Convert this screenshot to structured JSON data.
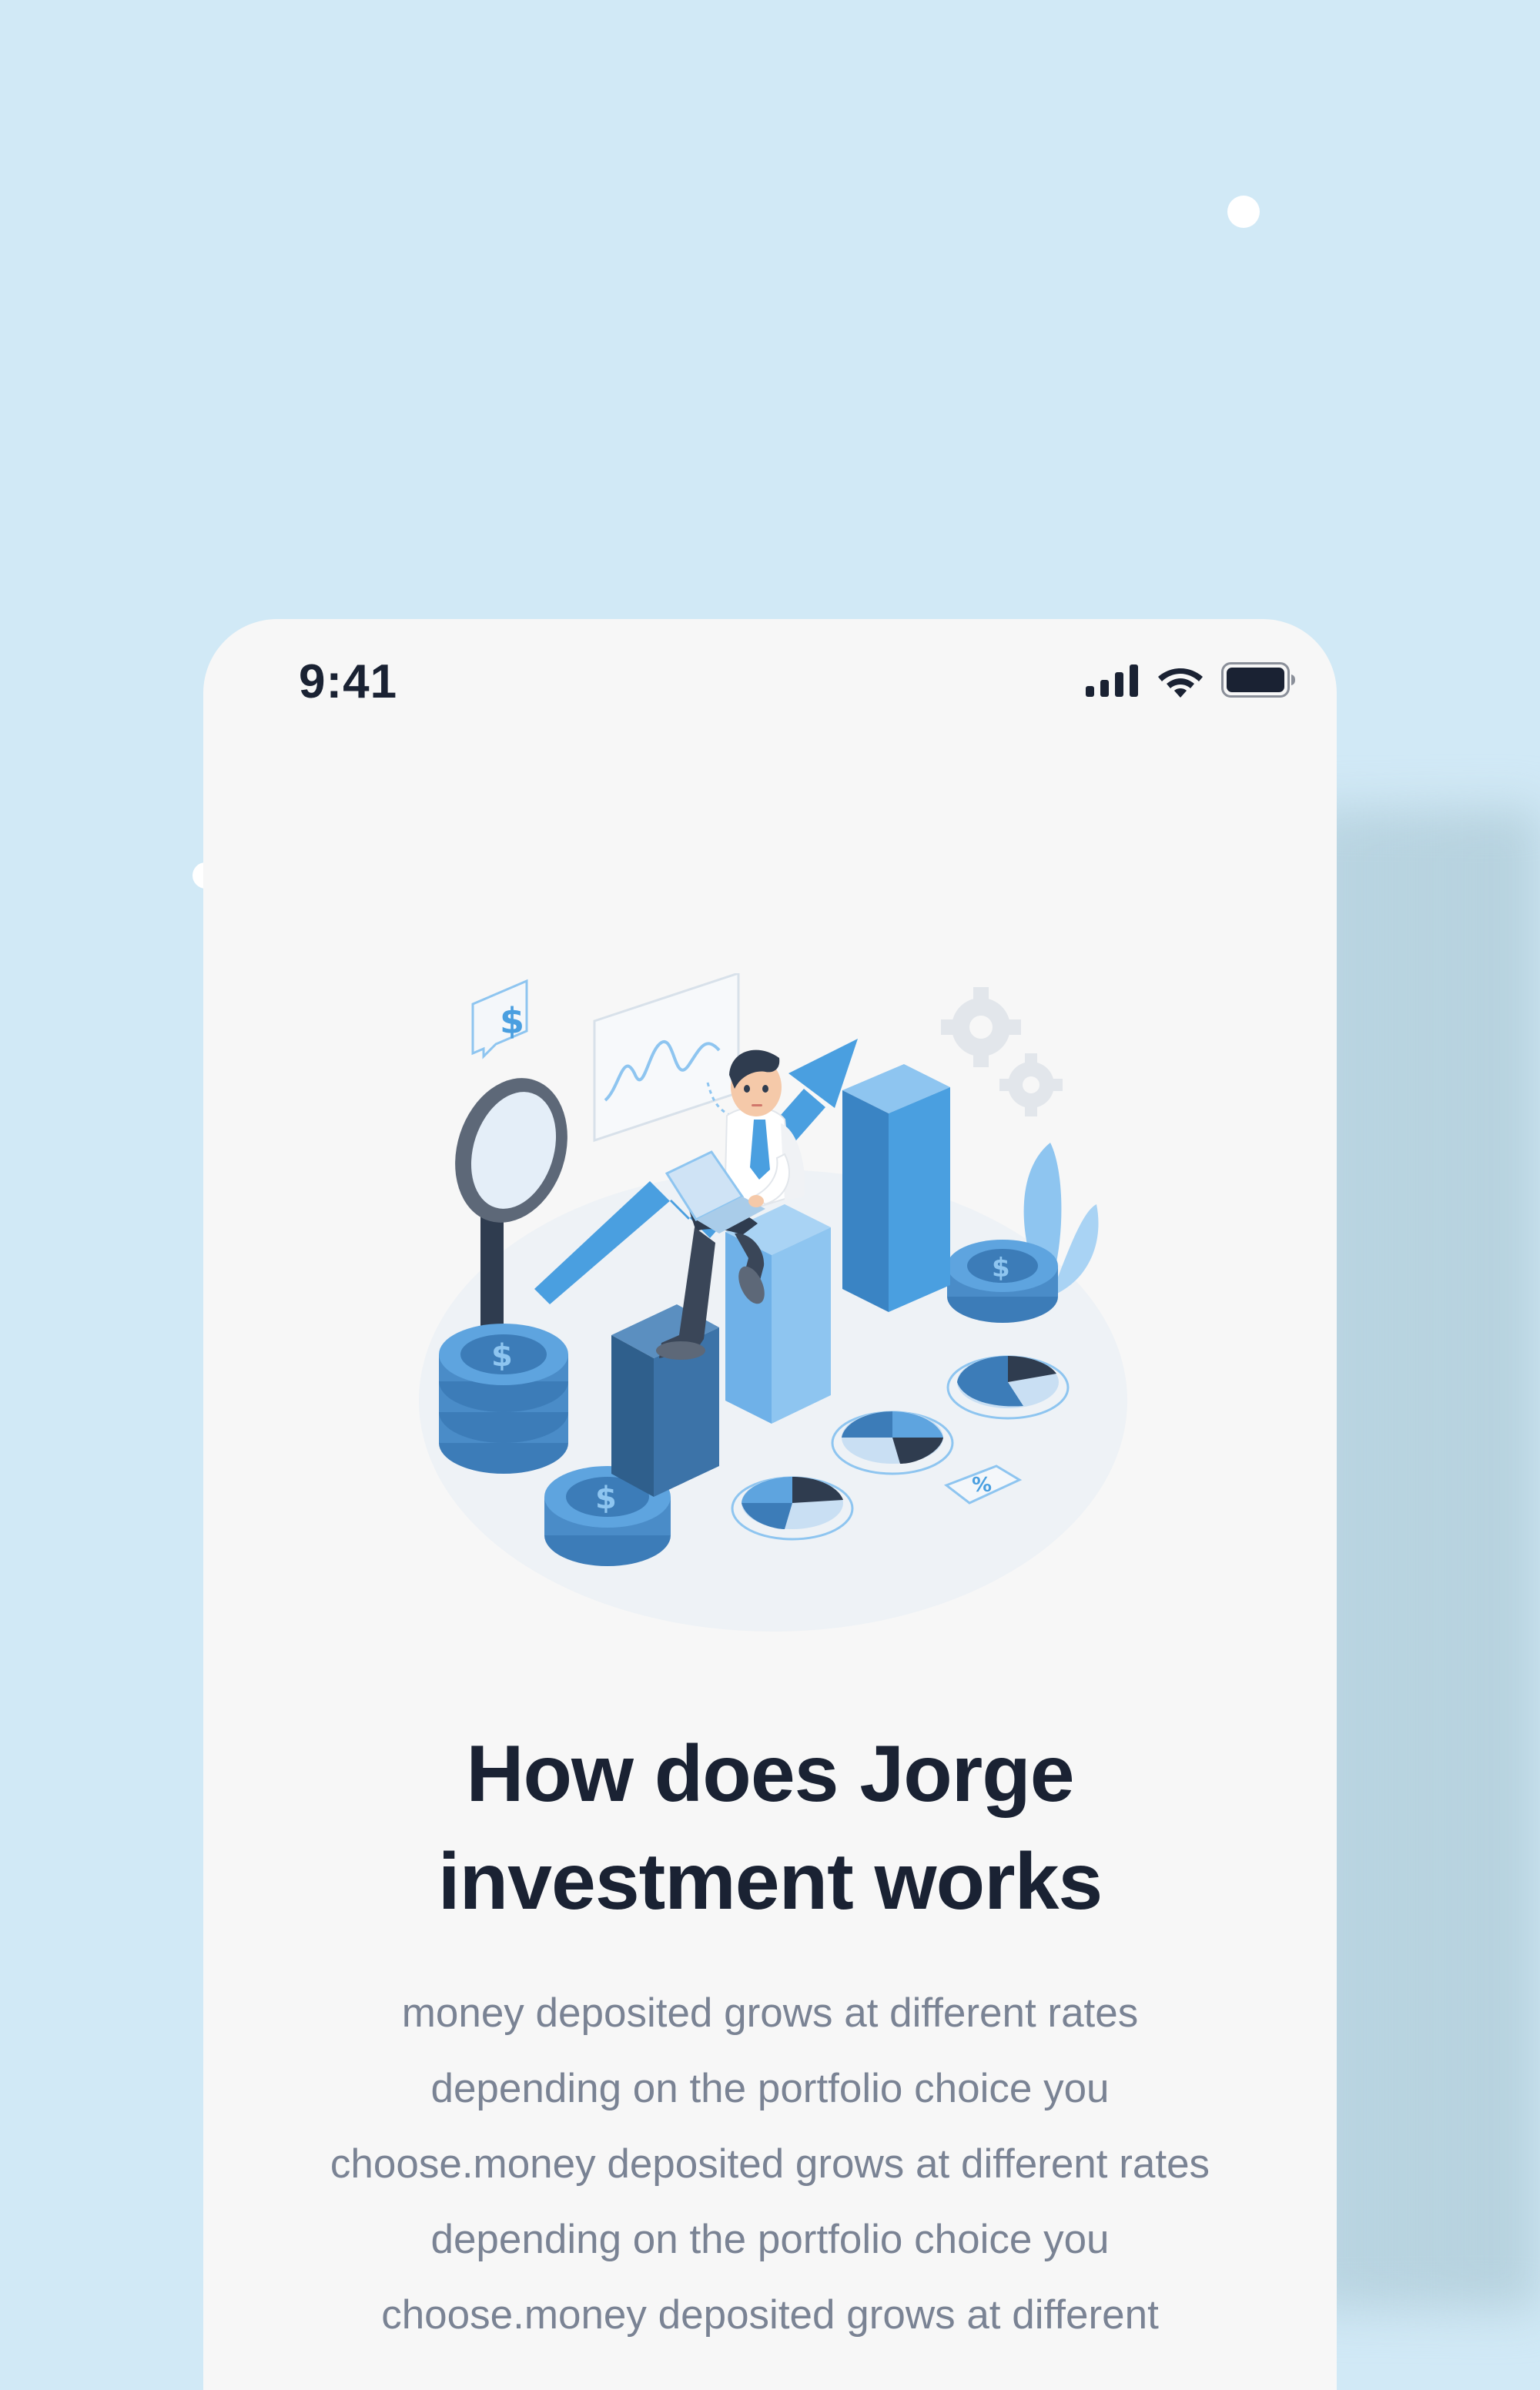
{
  "status_bar": {
    "time": "9:41",
    "icons": [
      "cellular-signal-icon",
      "wifi-icon",
      "battery-icon"
    ]
  },
  "illustration": {
    "name": "investment-growth-illustration",
    "symbols": {
      "dollar": "$",
      "percent": "%"
    }
  },
  "content": {
    "title_line1": "How does Jorge",
    "title_line2": "investment works",
    "body": "money deposited grows at different rates depending on the portfolio choice you choose.money deposited grows at different rates depending on the portfolio choice you choose.money deposited grows at different"
  },
  "colors": {
    "background": "#D1E9F6",
    "card": "#F7F7F7",
    "title": "#1A2233",
    "body": "#7A8394",
    "accent_blue": "#4A9FE0",
    "dark_blue": "#3672A8",
    "light_blue": "#8EC5F0"
  }
}
